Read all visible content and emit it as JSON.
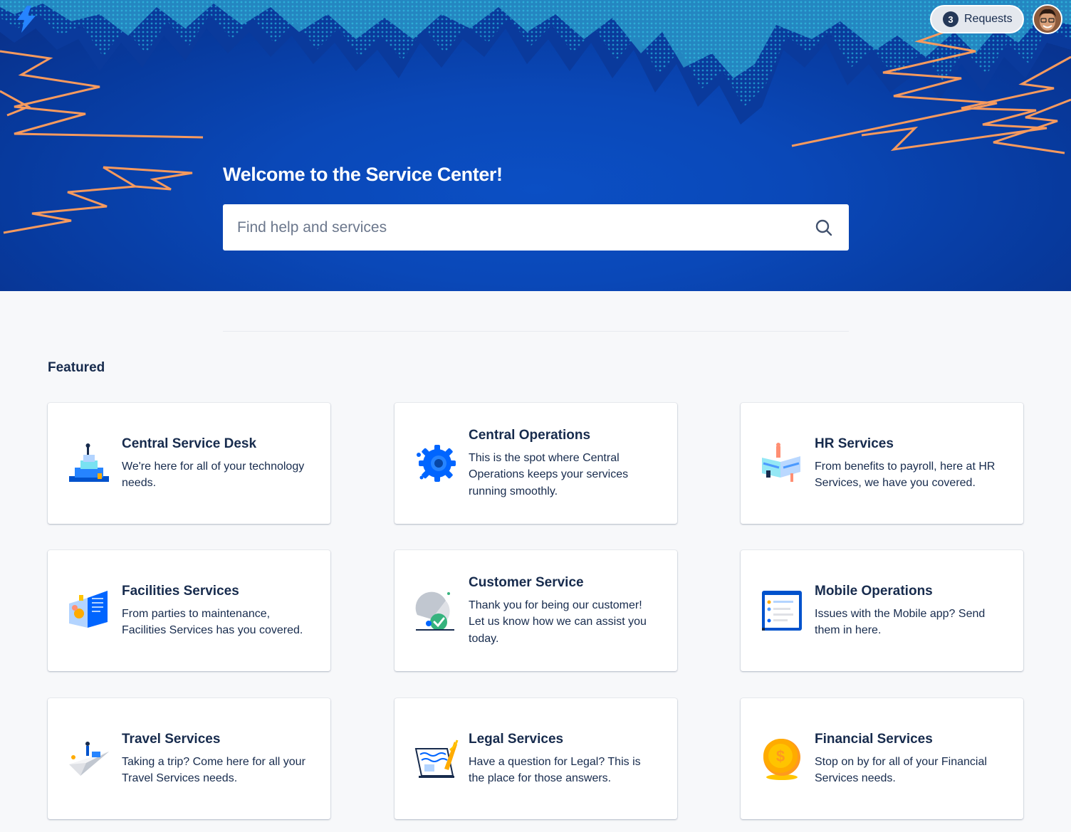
{
  "header": {
    "requests": {
      "count": "3",
      "label": "Requests"
    }
  },
  "hero": {
    "title": "Welcome to the Service Center!"
  },
  "search": {
    "placeholder": "Find help and services"
  },
  "featured": {
    "heading": "Featured",
    "cards": [
      {
        "title": "Central Service Desk",
        "description": "We're here for all of your technology needs.",
        "icon": "podium-icon"
      },
      {
        "title": "Central Operations",
        "description": "This is the spot where Central Operations keeps your services running smoothly.",
        "icon": "gear-icon"
      },
      {
        "title": "HR Services",
        "description": "From benefits to payroll, here at HR Services, we have you covered.",
        "icon": "people-icon"
      },
      {
        "title": "Facilities Services",
        "description": "From parties to maintenance, Facilities Services has you covered.",
        "icon": "building-icon"
      },
      {
        "title": "Customer Service",
        "description": "Thank you for being our customer! Let us know how we can assist you today.",
        "icon": "checkmark-icon"
      },
      {
        "title": "Mobile Operations",
        "description": "Issues with the Mobile app? Send them in here.",
        "icon": "mobile-icon"
      },
      {
        "title": "Travel Services",
        "description": "Taking a trip? Come here for all your Travel Services needs.",
        "icon": "paper-plane-icon"
      },
      {
        "title": "Legal Services",
        "description": "Have a question for Legal? This is the place for those answers.",
        "icon": "document-pen-icon"
      },
      {
        "title": "Financial Services",
        "description": "Stop on by for all of your Financial Services needs.",
        "icon": "coin-icon"
      }
    ]
  },
  "colors": {
    "hero_blue": "#0a48b8",
    "accent_cyan": "#3bc4e0",
    "lightning_orange": "#f79a5e",
    "text": "#172b4d"
  }
}
